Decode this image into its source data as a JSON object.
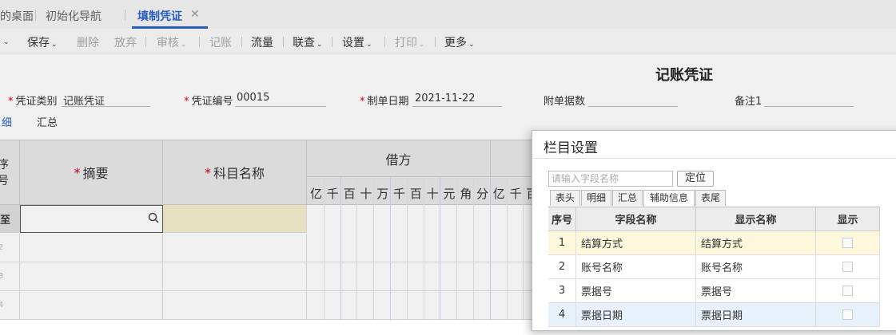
{
  "tabs": [
    {
      "label": "的桌面"
    },
    {
      "label": "初始化导航"
    },
    {
      "label": "填制凭证",
      "active": true,
      "close": "✕"
    }
  ],
  "toolbar": {
    "items": [
      {
        "label": "保存",
        "caret": "⌄"
      },
      {
        "label": "删除"
      },
      {
        "label": "放弃"
      },
      {
        "label": "审核",
        "caret": "⌄"
      },
      {
        "label": "记账"
      },
      {
        "label": "流量"
      },
      {
        "label": "联查",
        "caret": "⌄"
      },
      {
        "label": "设置",
        "caret": "⌄"
      },
      {
        "label": "打印",
        "caret": "⌄"
      },
      {
        "label": "更多",
        "caret": "⌄"
      }
    ],
    "left_caret": "⌄"
  },
  "form": {
    "title": "记账凭证",
    "req_mark": "*",
    "voucher_type_label": "凭证类别",
    "voucher_type_value": "记账凭证",
    "voucher_no_label": "凭证编号",
    "voucher_no_value": "00015",
    "date_label": "制单日期",
    "date_value": "2021-11-22",
    "attach_label": "附单据数",
    "remark_label": "备注1"
  },
  "subtabs": [
    {
      "label": "细"
    },
    {
      "label": "汇总"
    }
  ],
  "grid": {
    "seq_header": "序号",
    "summary_header": "摘要",
    "account_header": "科目名称",
    "debit_header": "借方",
    "digits": [
      "亿",
      "千",
      "百",
      "十",
      "万",
      "千",
      "百",
      "十",
      "元",
      "角",
      "分",
      "亿",
      "千",
      "百"
    ],
    "row_labels": [
      "至",
      "2",
      "3",
      "4"
    ]
  },
  "dialog": {
    "title": "栏目设置",
    "search_placeholder": "请输入字段名称",
    "locate_label": "定位",
    "tabs": [
      "表头",
      "明细",
      "汇总",
      "辅助信息",
      "表尾"
    ],
    "active_tab": "辅助信息",
    "columns": [
      "序号",
      "字段名称",
      "显示名称",
      "显示"
    ],
    "rows": [
      {
        "no": "1",
        "field": "结算方式",
        "display": "结算方式"
      },
      {
        "no": "2",
        "field": "账号名称",
        "display": "账号名称"
      },
      {
        "no": "3",
        "field": "票据号",
        "display": "票据号"
      },
      {
        "no": "4",
        "field": "票据日期",
        "display": "票据日期"
      }
    ]
  },
  "colors": {
    "accent": "#2b63c7",
    "required": "#d9001b",
    "highlight_row": "#fdf7dc",
    "selected_row": "#e8f1fb",
    "grid_highlight": "#f3efcd"
  },
  "icons": {
    "search": "search-icon",
    "close": "close-icon",
    "caret": "chevron-down-icon"
  }
}
